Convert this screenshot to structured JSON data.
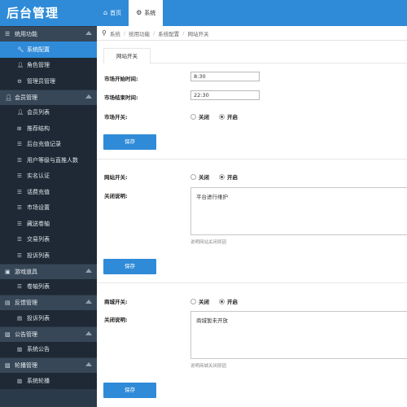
{
  "brand": {
    "title": "后台管理"
  },
  "topnav": [
    {
      "label": "首页",
      "icon": "home-icon"
    },
    {
      "label": "系统",
      "icon": "gear-icon"
    }
  ],
  "sidebar": {
    "groups": [
      {
        "label": "统用功能",
        "expanded": true,
        "items": [
          {
            "label": "系统配置",
            "icon": "wrench-icon",
            "active": true
          },
          {
            "label": "角色管理",
            "icon": "user-icon"
          },
          {
            "label": "管理员管理",
            "icon": "gear-icon"
          }
        ]
      },
      {
        "label": "会员管理",
        "expanded": true,
        "items": [
          {
            "label": "会员列表",
            "icon": "user-icon"
          },
          {
            "label": "推荐结构",
            "icon": "grid-icon"
          },
          {
            "label": "后台充值记录",
            "icon": "list-icon"
          },
          {
            "label": "用户等级与直推人数",
            "icon": "list-icon"
          },
          {
            "label": "实名认证",
            "icon": "list-icon"
          },
          {
            "label": "话费充值",
            "icon": "list-icon"
          },
          {
            "label": "市场设置",
            "icon": "list-icon"
          },
          {
            "label": "藏送卷轴",
            "icon": "list-icon"
          },
          {
            "label": "交易列表",
            "icon": "list-icon"
          },
          {
            "label": "投诉列表",
            "icon": "list-icon"
          }
        ]
      },
      {
        "label": "游戏道具",
        "expanded": true,
        "items": [
          {
            "label": "卷轴列表",
            "icon": "list-icon"
          }
        ]
      },
      {
        "label": "反馈管理",
        "expanded": true,
        "items": [
          {
            "label": "投诉列表",
            "icon": "doc-icon"
          }
        ]
      },
      {
        "label": "公告管理",
        "expanded": true,
        "items": [
          {
            "label": "系统公告",
            "icon": "image-icon"
          }
        ]
      },
      {
        "label": "轮播管理",
        "expanded": true,
        "items": [
          {
            "label": "系统轮播",
            "icon": "image-icon"
          }
        ]
      }
    ]
  },
  "breadcrumb": [
    "系统",
    "统用功能",
    "系统配置",
    "网站开关"
  ],
  "tab": {
    "label": "网站开关"
  },
  "market": {
    "start_label": "市场开始时间:",
    "start_value": "8:30",
    "end_label": "市场结束时间:",
    "end_value": "22:30",
    "switch_label": "市场开关:",
    "off_label": "关闭",
    "on_label": "开启",
    "save_label": "保存"
  },
  "site": {
    "switch_label": "网站开关:",
    "off_label": "关闭",
    "on_label": "开启",
    "reason_label": "关闭说明:",
    "reason_value": "平台进行维护",
    "help": "说明网站关闭原因",
    "save_label": "保存"
  },
  "mall": {
    "switch_label": "商城开关:",
    "off_label": "关闭",
    "on_label": "开启",
    "reason_label": "关闭说明:",
    "reason_value": "商城暂未开放",
    "help": "说明商城关闭原因",
    "save_label": "保存"
  },
  "colors": {
    "accent": "#2f8bd8",
    "sidebar_bg": "#2b3a4a",
    "sidebar_item_bg": "#1e2935"
  }
}
